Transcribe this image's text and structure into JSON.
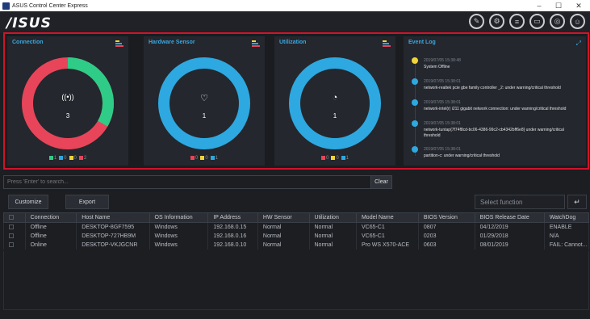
{
  "window": {
    "title": "ASUS Control Center Express",
    "minimize": "–",
    "maximize": "☐",
    "close": "✕"
  },
  "header": {
    "logo": "/ISUS",
    "icons": [
      "edit-icon",
      "gear-icon",
      "list-icon",
      "monitor-icon",
      "globe-icon",
      "user-icon"
    ]
  },
  "cards": [
    {
      "title": "Connection",
      "icon": "wifi-icon",
      "value": "3",
      "legend": [
        {
          "color": "#2ecc87",
          "count": "1"
        },
        {
          "color": "#2ea8e0",
          "count": "0"
        },
        {
          "color": "#f0d43a",
          "count": "0"
        },
        {
          "color": "#e8455a",
          "count": "2"
        }
      ]
    },
    {
      "title": "Hardware Sensor",
      "icon": "heart-pulse-icon",
      "value": "1",
      "legend": [
        {
          "color": "#e8455a",
          "count": "0"
        },
        {
          "color": "#f0d43a",
          "count": "0"
        },
        {
          "color": "#2ea8e0",
          "count": "1"
        }
      ]
    },
    {
      "title": "Utilization",
      "icon": "gauge-icon",
      "value": "1",
      "legend": [
        {
          "color": "#e8455a",
          "count": "0"
        },
        {
          "color": "#f0d43a",
          "count": "0"
        },
        {
          "color": "#2ea8e0",
          "count": "1"
        }
      ]
    }
  ],
  "event_log": {
    "title": "Event Log",
    "entries": [
      {
        "time": "2019/07/05 15:38:48",
        "message": "System Offline",
        "color": "#f0d43a"
      },
      {
        "time": "2019/07/05 15:38:01",
        "message": "network-realtek pcie gbe family controller _2: under warning/critical threshold",
        "color": "#2ea8e0"
      },
      {
        "time": "2019/07/05 15:38:01",
        "message": "network-intel(r) i211 gigabit network connection: under warning/critical threshold",
        "color": "#2ea8e0"
      },
      {
        "time": "2019/07/05 15:38:01",
        "message": "network-tuntap{7f74f8cd-bc06-4386-99c2-cb4342bff6e8}     under     warning/critical threshold",
        "color": "#2ea8e0"
      },
      {
        "time": "2019/07/05 15:38:01",
        "message": "partition-c: under warning/critical threshold",
        "color": "#2ea8e0"
      }
    ]
  },
  "search": {
    "placeholder": "Press 'Enter' to search...",
    "clear": "Clear"
  },
  "toolbar": {
    "customize": "Customize",
    "export": "Export",
    "select_placeholder": "Select function",
    "enter": "↵"
  },
  "table": {
    "columns": [
      "",
      "Connection",
      "Host Name",
      "OS Information",
      "IP Address",
      "HW Sensor",
      "Utilization",
      "Model Name",
      "BIOS Version",
      "BIOS Release Date",
      "WatchDog"
    ],
    "rows": [
      [
        "",
        "Offline",
        "DESKTOP-8GF7595",
        "Windows",
        "192.168.0.15",
        "Normal",
        "Normal",
        "VC65-C1",
        "0807",
        "04/12/2019",
        "ENABLE"
      ],
      [
        "",
        "Offline",
        "DESKTOP-727HB9M",
        "Windows",
        "192.168.0.16",
        "Normal",
        "Normal",
        "VC65-C1",
        "0203",
        "01/29/2018",
        "N/A"
      ],
      [
        "",
        "Online",
        "DESKTOP-VKJGCNR",
        "Windows",
        "192.168.0.10",
        "Normal",
        "Normal",
        "Pro WS X570-ACE",
        "0603",
        "08/01/2019",
        "FAIL: Cannot..."
      ]
    ]
  },
  "colors": {
    "accent": "#3aa7e0",
    "highlight_border": "#d0132a",
    "green": "#2ecc87",
    "red": "#e8455a",
    "blue": "#2ea8e0",
    "yellow": "#f0d43a"
  }
}
